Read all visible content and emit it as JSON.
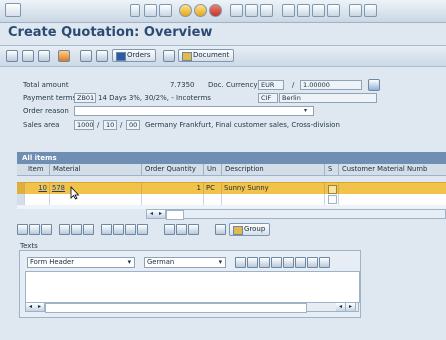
{
  "window": {
    "title": "Create Quotation: Overview"
  },
  "toolbar": {
    "orders_label": "Orders",
    "document_label": "Document"
  },
  "header": {
    "total_amount_label": "Total amount",
    "total_amount_value": "7.7350",
    "doc_currency_label": "Doc. Currency",
    "currency": "EUR",
    "rate_sep": "/",
    "exchange_rate": "1.00000",
    "payment_terms_label": "Payment terms",
    "payment_terms_code": "ZB01",
    "payment_terms_desc": "14 Days 3%, 30/2%, -",
    "incoterms_label": "Incoterms",
    "incoterms_code": "CIF",
    "incoterms_place": "Berlin",
    "order_reason_label": "Order reason",
    "sales_area_label": "Sales area",
    "sales_org": "1000",
    "dist_channel": "10",
    "division": "00",
    "sales_area_desc": "Germany Frankfurt, Final customer sales, Cross-division"
  },
  "items": {
    "tab_label": "All items",
    "columns": [
      "Item",
      "Material",
      "Order Quantity",
      "Un",
      "Description",
      "S",
      "Customer Material Numb"
    ],
    "rows": [
      {
        "item": "10",
        "material": "578",
        "qty": "1",
        "unit": "PC",
        "description": "Sunny Sunny"
      }
    ]
  },
  "lower_toolbar": {
    "group_label": "Group"
  },
  "texts": {
    "label": "Texts",
    "text_type": "Form Header",
    "language": "German"
  },
  "colors": {
    "title": "#2a4c73",
    "row_highlight": "#f1c34a",
    "table_header": "#6f8eb2"
  }
}
